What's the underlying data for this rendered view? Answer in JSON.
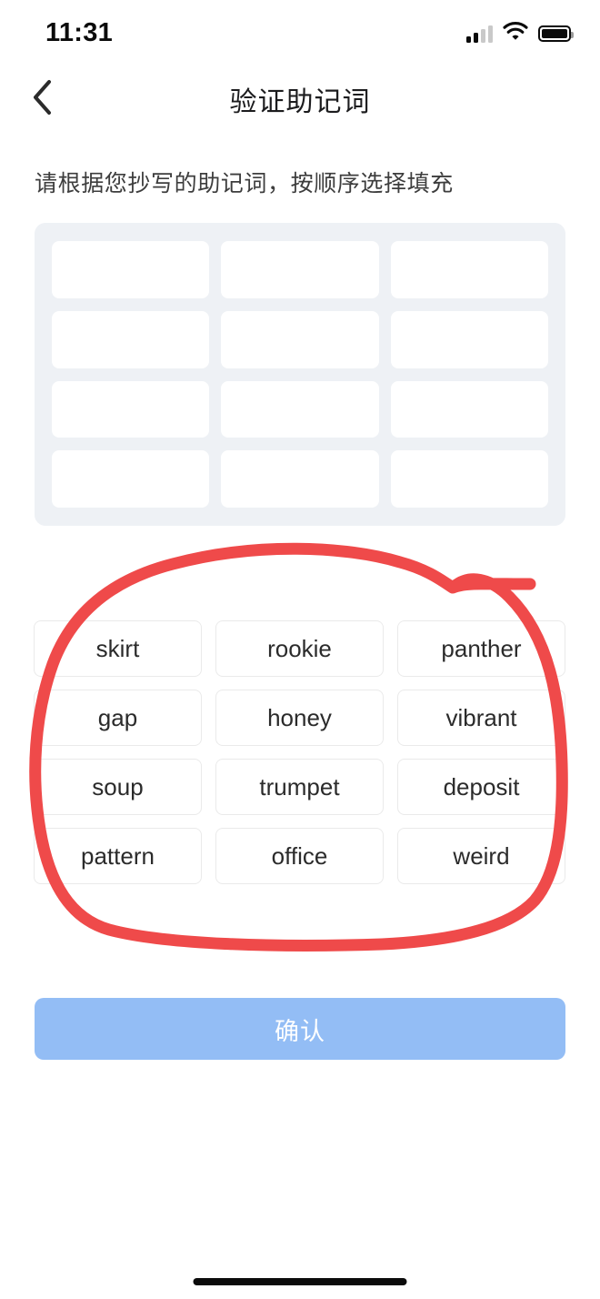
{
  "status_bar": {
    "time": "11:31",
    "signal_icon": "cellular-signal-icon",
    "wifi_icon": "wifi-icon",
    "battery_icon": "battery-full-icon"
  },
  "nav": {
    "back_icon": "chevron-left-icon",
    "title": "验证助记词"
  },
  "instruction": "请根据您抄写的助记词，按顺序选择填充",
  "slot_panel": {
    "rows": 4,
    "columns": 3,
    "slot_count": 12,
    "slots": [
      "",
      "",
      "",
      "",
      "",
      "",
      "",
      "",
      "",
      "",
      "",
      ""
    ],
    "background_color": "#eef1f5",
    "slot_color": "#ffffff"
  },
  "word_bank": {
    "rows": 4,
    "columns": 3,
    "words": [
      "skirt",
      "rookie",
      "panther",
      "gap",
      "honey",
      "vibrant",
      "soup",
      "trumpet",
      "deposit",
      "pattern",
      "office",
      "weird"
    ]
  },
  "confirm_button": {
    "label": "确认",
    "color": "#93bdf5",
    "text_color": "#ffffff"
  },
  "annotation": {
    "type": "hand-drawn-circle",
    "color": "#ef4a4a",
    "stroke_width": 13,
    "target": "word-bank-grid"
  },
  "home_indicator": {
    "color": "#0b0b0b"
  }
}
